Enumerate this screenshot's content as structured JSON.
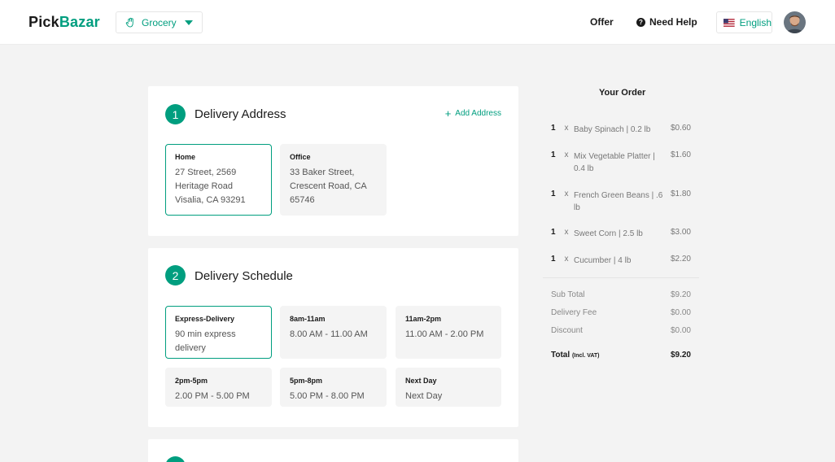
{
  "header": {
    "logo_part1": "Pick",
    "logo_part2": "Bazar",
    "category_label": "Grocery",
    "category_icon": "hand-icon",
    "offer_label": "Offer",
    "help_label": "Need Help",
    "language_label": "English",
    "accent_color": "#009e7f"
  },
  "address": {
    "step": "1",
    "title": "Delivery Address",
    "add_label": "Add Address",
    "options": [
      {
        "title": "Home",
        "body": "27 Street, 2569 Heritage Road Visalia, CA 93291",
        "selected": true
      },
      {
        "title": "Office",
        "body": "33 Baker Street, Crescent Road, CA 65746",
        "selected": false
      }
    ]
  },
  "schedule": {
    "step": "2",
    "title": "Delivery Schedule",
    "options": [
      {
        "title": "Express-Delivery",
        "body": "90 min express delivery",
        "selected": true
      },
      {
        "title": "8am-11am",
        "body": "8.00 AM - 11.00 AM",
        "selected": false
      },
      {
        "title": "11am-2pm",
        "body": "11.00 AM - 2.00 PM",
        "selected": false
      },
      {
        "title": "2pm-5pm",
        "body": "2.00 PM - 5.00 PM",
        "selected": false
      },
      {
        "title": "5pm-8pm",
        "body": "5.00 PM - 8.00 PM",
        "selected": false
      },
      {
        "title": "Next Day",
        "body": "Next Day",
        "selected": false
      }
    ]
  },
  "order": {
    "title": "Your Order",
    "items": [
      {
        "qty": "1",
        "x": "x",
        "name": "Baby Spinach | 0.2 lb",
        "price": "$0.60"
      },
      {
        "qty": "1",
        "x": "x",
        "name": "Mix Vegetable Platter | 0.4 lb",
        "price": "$1.60"
      },
      {
        "qty": "1",
        "x": "x",
        "name": "French Green Beans | .6 lb",
        "price": "$1.80"
      },
      {
        "qty": "1",
        "x": "x",
        "name": "Sweet Corn | 2.5 lb",
        "price": "$3.00"
      },
      {
        "qty": "1",
        "x": "x",
        "name": "Cucumber | 4 lb",
        "price": "$2.20"
      }
    ],
    "subtotal_label": "Sub Total",
    "subtotal_value": "$9.20",
    "delivery_label": "Delivery Fee",
    "delivery_value": "$0.00",
    "discount_label": "Discount",
    "discount_value": "$0.00",
    "total_label": "Total",
    "total_vat": "(Incl. VAT)",
    "total_value": "$9.20"
  }
}
